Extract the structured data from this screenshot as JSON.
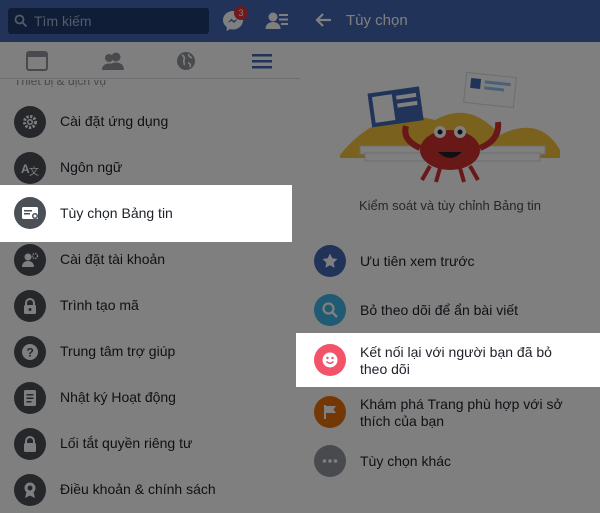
{
  "left": {
    "search": {
      "placeholder": "Tìm kiếm"
    },
    "messenger_badge": "3",
    "tabs": [
      "news-feed",
      "friends",
      "notifications",
      "menu"
    ],
    "menu_cut_text": "Thiết bị & dịch vụ",
    "menu_items": [
      {
        "label": "Cài đặt ứng dụng",
        "icon": "gear-icon"
      },
      {
        "label": "Ngôn ngữ",
        "icon": "language-icon"
      },
      {
        "label": "Tùy chọn Bảng tin",
        "icon": "news-feed-preferences-icon"
      },
      {
        "label": "Cài đặt tài khoản",
        "icon": "account-settings-icon"
      },
      {
        "label": "Trình tạo mã",
        "icon": "lock-icon"
      },
      {
        "label": "Trung tâm trợ giúp",
        "icon": "help-icon"
      },
      {
        "label": "Nhật ký Hoạt động",
        "icon": "activity-log-icon"
      },
      {
        "label": "Lối tắt quyền riêng tư",
        "icon": "privacy-lock-icon"
      },
      {
        "label": "Điều khoản & chính sách",
        "icon": "terms-icon"
      }
    ]
  },
  "right": {
    "title": "Tùy chọn",
    "subtitle": "Kiểm soát và tùy chỉnh Bảng tin",
    "options": [
      {
        "label": "Ưu tiên xem trước",
        "icon": "star-icon",
        "color": "#4267b2"
      },
      {
        "label": "Bỏ theo dõi để ẩn bài viết",
        "icon": "search-icon",
        "color": "#42b4e6"
      },
      {
        "label": "Kết nối lại với người bạn đã bỏ theo dõi",
        "icon": "smile-icon",
        "color": "#f35369"
      },
      {
        "label": "Khám phá Trang phù hợp với sở thích của bạn",
        "icon": "flag-icon",
        "color": "#e9710f"
      },
      {
        "label": "Tùy chọn khác",
        "icon": "more-icon",
        "color": "#90949c"
      }
    ]
  },
  "colors": {
    "brand": "#4267b2",
    "dim": "rgba(0,0,0,0.5)"
  }
}
